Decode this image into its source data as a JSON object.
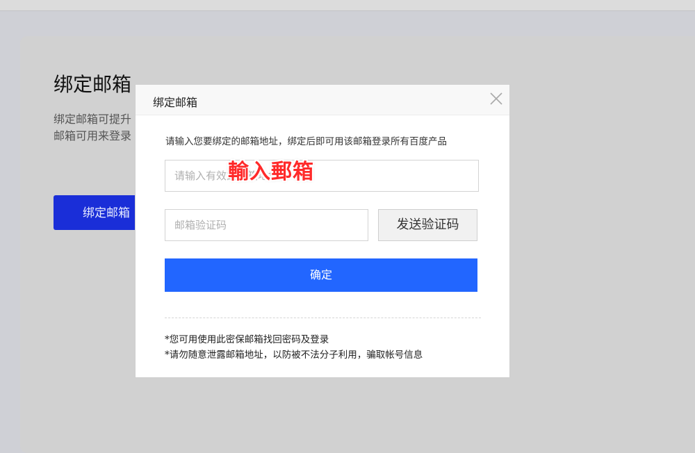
{
  "page": {
    "title": "绑定邮箱",
    "description_lines": [
      "绑定邮箱可提升",
      "邮箱可用来登录"
    ],
    "bind_button_label": "绑定邮箱"
  },
  "modal": {
    "title": "绑定邮箱",
    "hint": "请输入您要绑定的邮箱地址，绑定后即可用该邮箱登录所有百度产品",
    "email_placeholder": "请输入有效的邮箱地址",
    "code_placeholder": "邮箱验证码",
    "send_code_label": "发送验证码",
    "confirm_label": "确定",
    "notes": [
      "*您可用使用此密保邮箱找回密码及登录",
      "*请勿随意泄露邮箱地址，以防被不法分子利用，骗取帐号信息"
    ]
  },
  "annotation": {
    "text": "輸入郵箱",
    "color": "#ff2a2a"
  },
  "colors": {
    "primary_button": "#2266ff",
    "bind_button": "#1a2ed8"
  }
}
